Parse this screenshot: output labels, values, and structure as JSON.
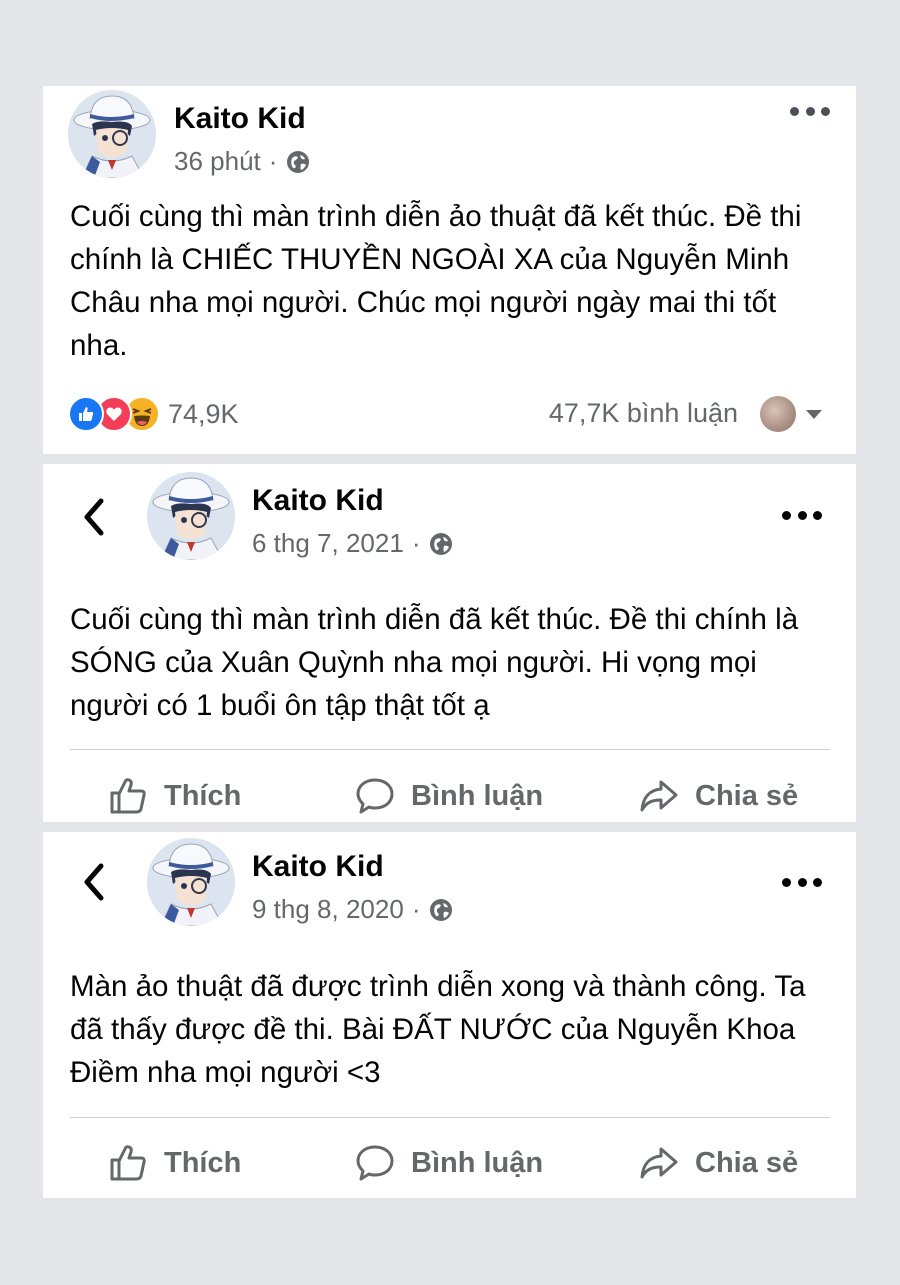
{
  "posts": [
    {
      "author": "Kaito Kid",
      "time": "36 phút",
      "text": "Cuối cùng thì màn trình diễn ảo thuật đã kết thúc. Đề thi chính là CHIẾC THUYỀN NGOÀI XA của Nguyễn Minh Châu nha mọi người. Chúc mọi người ngày mai thi tốt nha.",
      "reaction_count": "74,9K",
      "comment_count": "47,7K bình luận",
      "reaction_icons": [
        "like-icon",
        "love-icon",
        "haha-icon"
      ]
    },
    {
      "author": "Kaito Kid",
      "time": "6 thg 7, 2021",
      "text": "Cuối cùng thì màn trình diễn đã kết thúc. Đề thi chính là SÓNG của Xuân Quỳnh nha mọi người. Hi vọng mọi người có 1 buổi ôn tập thật tốt ạ"
    },
    {
      "author": "Kaito Kid",
      "time": "9 thg 8, 2020",
      "text": "Màn ảo thuật đã được trình diễn xong và thành công. Ta đã thấy được đề thi. Bài ĐẤT NƯỚC của Nguyễn Khoa Điềm nha mọi người <3"
    }
  ],
  "actions": {
    "like": "Thích",
    "comment": "Bình luận",
    "share": "Chia sẻ"
  },
  "meta_separator": "·",
  "colors": {
    "background": "#e4e6ea",
    "card": "#ffffff",
    "secondary_text": "#65676b",
    "like_blue": "#1877f2",
    "love_red": "#f33e58",
    "haha_yellow": "#f7b125"
  }
}
